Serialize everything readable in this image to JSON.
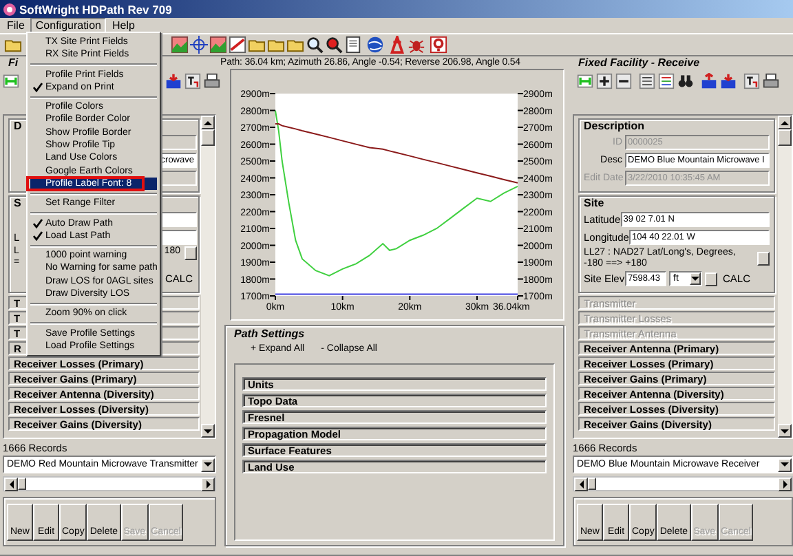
{
  "window": {
    "title": "SoftWright HDPath Rev 709"
  },
  "menu_bar": [
    {
      "label": "File",
      "selected": false
    },
    {
      "label": "Configuration",
      "selected": true
    },
    {
      "label": "Help",
      "selected": false
    }
  ],
  "config_menu": {
    "items": [
      {
        "kind": "item",
        "label": "TX Site Print Fields",
        "checked": false,
        "selected": false
      },
      {
        "kind": "item",
        "label": "RX Site Print Fields",
        "checked": false,
        "selected": false
      },
      {
        "kind": "separator"
      },
      {
        "kind": "item",
        "label": "Profile Print Fields",
        "checked": false,
        "selected": false
      },
      {
        "kind": "item",
        "label": "Expand on Print",
        "checked": true,
        "selected": false
      },
      {
        "kind": "separator"
      },
      {
        "kind": "item",
        "label": "Profile Colors",
        "checked": false,
        "selected": false
      },
      {
        "kind": "item",
        "label": "Profile Border Color",
        "checked": false,
        "selected": false
      },
      {
        "kind": "item",
        "label": "Show Profile Border",
        "checked": false,
        "selected": false
      },
      {
        "kind": "item",
        "label": "Show Profile Tip",
        "checked": false,
        "selected": false
      },
      {
        "kind": "item",
        "label": "Land Use Colors",
        "checked": false,
        "selected": false
      },
      {
        "kind": "item",
        "label": "Google Earth Colors",
        "checked": false,
        "selected": false
      },
      {
        "kind": "item",
        "label": "Profile Label Font: 8",
        "checked": false,
        "selected": true,
        "annotated": true
      },
      {
        "kind": "separator"
      },
      {
        "kind": "item",
        "label": "Set Range Filter",
        "checked": false,
        "selected": false
      },
      {
        "kind": "separator"
      },
      {
        "kind": "item",
        "label": "Auto Draw Path",
        "checked": true,
        "selected": false
      },
      {
        "kind": "item",
        "label": "Load Last Path",
        "checked": true,
        "selected": false
      },
      {
        "kind": "separator"
      },
      {
        "kind": "item",
        "label": "1000 point warning",
        "checked": false,
        "selected": false
      },
      {
        "kind": "item",
        "label": "No Warning for same path",
        "checked": false,
        "selected": false
      },
      {
        "kind": "item",
        "label": "Draw LOS for 0AGL sites",
        "checked": false,
        "selected": false
      },
      {
        "kind": "item",
        "label": "Draw Diversity LOS",
        "checked": false,
        "selected": false
      },
      {
        "kind": "separator"
      },
      {
        "kind": "item",
        "label": "Zoom 90% on click",
        "checked": false,
        "selected": false
      },
      {
        "kind": "separator"
      },
      {
        "kind": "item",
        "label": "Save Profile Settings",
        "checked": false,
        "selected": false
      },
      {
        "kind": "item",
        "label": "Load Profile Settings",
        "checked": false,
        "selected": false
      }
    ]
  },
  "transmit_panel": {
    "title": "Fi",
    "description": {
      "title": "D",
      "fields": [
        {
          "disabled": true
        },
        {
          "value": "crowave",
          "disabled": false
        },
        {
          "disabled": true
        }
      ]
    },
    "site": {
      "title": "S",
      "longitude_label": "L",
      "datum_start": "L",
      "datum_line2": "=",
      "datum_end": "180",
      "calc": "CALC"
    },
    "sections": [
      {
        "label": "T",
        "disabled": false
      },
      {
        "label": "T",
        "disabled": false
      },
      {
        "label": "T",
        "disabled": false
      },
      {
        "label": "R",
        "disabled": false
      },
      {
        "label": "Receiver Losses (Primary)",
        "disabled": false
      },
      {
        "label": "Receiver Gains (Primary)",
        "disabled": false
      },
      {
        "label": "Receiver Antenna (Diversity)",
        "disabled": false
      },
      {
        "label": "Receiver Losses (Diversity)",
        "disabled": false
      },
      {
        "label": "Receiver Gains (Diversity)",
        "disabled": false
      }
    ],
    "records": "1666 Records",
    "selector": "DEMO Red Mountain Microwave Transmitter",
    "buttons": [
      {
        "label": "New",
        "disabled": false
      },
      {
        "label": "Edit",
        "disabled": false
      },
      {
        "label": "Copy",
        "disabled": false
      },
      {
        "label": "Delete",
        "disabled": false
      },
      {
        "label": "Save",
        "disabled": true
      },
      {
        "label": "Cancel",
        "disabled": true
      }
    ]
  },
  "profile": {
    "path_info": "Path: 36.04 km; Azimuth 26.86, Angle -0.54; Reverse 206.98, Angle 0.54",
    "chart_data": {
      "type": "line",
      "x": [
        0,
        0.5,
        1,
        2,
        3,
        4,
        6,
        8,
        10,
        12,
        14,
        16,
        17,
        18,
        20,
        22,
        24,
        26,
        28,
        30,
        32,
        34,
        36.04
      ],
      "series": [
        {
          "color": "#40d040",
          "values": [
            2800,
            2680,
            2500,
            2250,
            2030,
            1920,
            1850,
            1820,
            1860,
            1890,
            1940,
            2010,
            1970,
            1980,
            2030,
            2060,
            2100,
            2160,
            2220,
            2280,
            2260,
            2310,
            2350
          ]
        },
        {
          "color": "#8b1a1a",
          "values": [
            2720,
            2720,
            2710,
            2700,
            2690,
            2680,
            2660,
            2640,
            2620,
            2600,
            2580,
            2570,
            2560,
            2550,
            2530,
            2510,
            2490,
            2470,
            2450,
            2430,
            2410,
            2390,
            2370
          ]
        },
        {
          "color": "#4040e0",
          "values": [
            1710,
            1710,
            1710,
            1710,
            1710,
            1710,
            1710,
            1710,
            1710,
            1710,
            1710,
            1710,
            1710,
            1710,
            1710,
            1710,
            1710,
            1710,
            1710,
            1710,
            1710,
            1710,
            1710
          ]
        }
      ],
      "xlim": [
        0,
        36.04
      ],
      "ylim": [
        1700,
        2900
      ],
      "xticks": [
        {
          "value": 0,
          "label": "0km"
        },
        {
          "value": 10,
          "label": "10km"
        },
        {
          "value": 20,
          "label": "20km"
        },
        {
          "value": 30,
          "label": "30km"
        },
        {
          "value": 36.04,
          "label": "36.04km"
        }
      ],
      "yticks": [
        {
          "value": 2900,
          "label": "2900m"
        },
        {
          "value": 2800,
          "label": "2800m"
        },
        {
          "value": 2700,
          "label": "2700m"
        },
        {
          "value": 2600,
          "label": "2600m"
        },
        {
          "value": 2500,
          "label": "2500m"
        },
        {
          "value": 2400,
          "label": "2400m"
        },
        {
          "value": 2300,
          "label": "2300m"
        },
        {
          "value": 2200,
          "label": "2200m"
        },
        {
          "value": 2100,
          "label": "2100m"
        },
        {
          "value": 2000,
          "label": "2000m"
        },
        {
          "value": 1900,
          "label": "1900m"
        },
        {
          "value": 1800,
          "label": "1800m"
        },
        {
          "value": 1700,
          "label": "1700m"
        }
      ]
    },
    "path_settings": {
      "title": "Path Settings",
      "actions": [
        "+ Expand All",
        "- Collapse All"
      ],
      "sections": [
        "Units",
        "Topo Data",
        "Fresnel",
        "Propagation Model",
        "Surface Features",
        "Land Use"
      ]
    }
  },
  "receive_panel": {
    "title": "Fixed Facility - Receive",
    "description": {
      "title": "Description",
      "fields": [
        {
          "label": "ID",
          "value": "0000025",
          "disabled": true
        },
        {
          "label": "Desc",
          "value": "DEMO Blue Mountain Microwave I",
          "disabled": false
        },
        {
          "label": "Edit Date",
          "value": "3/22/2010 10:35:45 AM",
          "disabled": true
        }
      ]
    },
    "site": {
      "title": "Site",
      "fields": [
        {
          "label": "Latitude",
          "value": "39 02 7.01 N"
        },
        {
          "label": "Longitude",
          "value": "104 40 22.01 W"
        }
      ],
      "datum": "LL27 : NAD27 Lat/Long's, Degrees, -180 ==> +180",
      "elevation_label": "Site Elev",
      "elevation": "7598.43",
      "unit": "ft",
      "calc": "CALC"
    },
    "sections": [
      {
        "label": "Transmitter",
        "disabled": true
      },
      {
        "label": "Transmitter Losses",
        "disabled": true
      },
      {
        "label": "Transmitter Antenna",
        "disabled": true
      },
      {
        "label": "Receiver Antenna (Primary)",
        "disabled": false
      },
      {
        "label": "Receiver Losses (Primary)",
        "disabled": false
      },
      {
        "label": "Receiver Gains (Primary)",
        "disabled": false
      },
      {
        "label": "Receiver Antenna (Diversity)",
        "disabled": false
      },
      {
        "label": "Receiver Losses (Diversity)",
        "disabled": false
      },
      {
        "label": "Receiver Gains (Diversity)",
        "disabled": false
      }
    ],
    "records": "1666 Records",
    "selector": "DEMO Blue Mountain Microwave Receiver",
    "buttons": [
      {
        "label": "New",
        "disabled": false
      },
      {
        "label": "Edit",
        "disabled": false
      },
      {
        "label": "Copy",
        "disabled": false
      },
      {
        "label": "Delete",
        "disabled": false
      },
      {
        "label": "Save",
        "disabled": true
      },
      {
        "label": "Cancel",
        "disabled": true
      }
    ]
  }
}
